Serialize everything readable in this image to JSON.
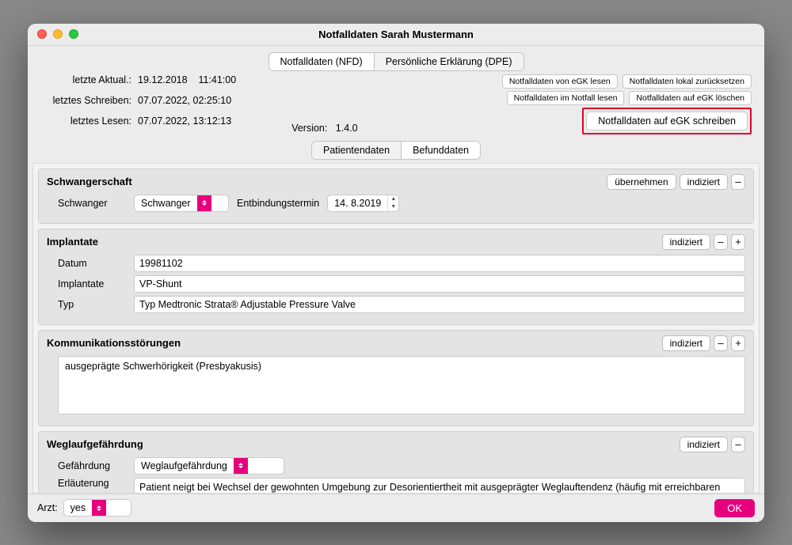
{
  "title": "Notfalldaten Sarah Mustermann",
  "topTabs": {
    "nfd": "Notfalldaten (NFD)",
    "dpe": "Persönliche Erklärung (DPE)"
  },
  "meta": {
    "lastUpdateLabel": "letzte Aktual.:",
    "lastUpdateValue": "19.12.2018    11:41:00",
    "lastWriteLabel": "letztes Schreiben:",
    "lastWriteValue": "07.07.2022, 02:25:10",
    "lastReadLabel": "letztes Lesen:",
    "lastReadValue": "07.07.2022, 13:12:13",
    "versionLabel": "Version:",
    "versionValue": "1.4.0"
  },
  "actionButtons": {
    "readFromEgk": "Notfalldaten von eGK lesen",
    "resetLocal": "Notfalldaten lokal zurücksetzen",
    "readEmergency": "Notfalldaten im Notfall lesen",
    "deleteOnEgk": "Notfalldaten auf eGK löschen",
    "writeToEgk": "Notfalldaten auf eGK schreiben"
  },
  "subTabs": {
    "patient": "Patientendaten",
    "befund": "Befunddaten"
  },
  "common": {
    "uebernehmen": "übernehmen",
    "indiziert": "indiziert",
    "minus": "–",
    "plus": "+"
  },
  "schwanger": {
    "title": "Schwangerschaft",
    "label1": "Schwanger",
    "value1": "Schwanger",
    "label2": "Entbindungstermin",
    "value2": "14.  8.2019"
  },
  "implantate": {
    "title": "Implantate",
    "datumLabel": "Datum",
    "datumValue": "19981102",
    "implLabel": "Implantate",
    "implValue": "VP-Shunt",
    "typLabel": "Typ",
    "typValue": "Typ Medtronic Strata® Adjustable Pressure Valve"
  },
  "komm": {
    "title": "Kommunikationsstörungen",
    "text": "ausgeprägte Schwerhörigkeit (Presbyakusis)"
  },
  "weglauf": {
    "title": "Weglaufgefährdung",
    "gefLabel": "Gefährdung",
    "gefValue": "Weglaufgefährdung",
    "erklLabel": "Erläuterung",
    "erklValue": "Patient neigt bei Wechsel der gewohnten Umgebung zur Desorientiertheit mit ausgeprägter Weglauftendenz (häufig mit erreichbaren Öffentlichen Verkehrsmitteln nach Hause!)"
  },
  "footer": {
    "arztLabel": "Arzt:",
    "arztValue": "yes",
    "ok": "OK"
  }
}
